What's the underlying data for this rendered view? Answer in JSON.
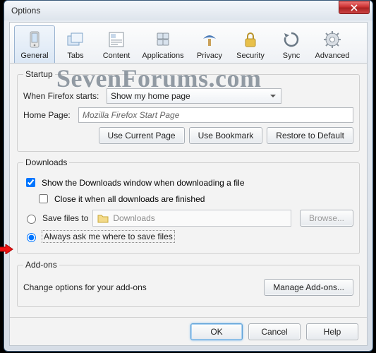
{
  "window": {
    "title": "Options"
  },
  "tabs": {
    "general": "General",
    "tabs": "Tabs",
    "content": "Content",
    "applications": "Applications",
    "privacy": "Privacy",
    "security": "Security",
    "sync": "Sync",
    "advanced": "Advanced"
  },
  "watermark": "SevenForums.com",
  "startup": {
    "legend": "Startup",
    "when_label": "When Firefox starts:",
    "when_value": "Show my home page",
    "home_label": "Home Page:",
    "home_value": "Mozilla Firefox Start Page",
    "btn_current": "Use Current Page",
    "btn_bookmark": "Use Bookmark",
    "btn_restore": "Restore to Default"
  },
  "downloads": {
    "legend": "Downloads",
    "show_window": "Show the Downloads window when downloading a file",
    "close_when_done": "Close it when all downloads are finished",
    "save_to_label": "Save files to",
    "save_to_folder": "Downloads",
    "browse": "Browse...",
    "ask_label": "Always ask me where to save files"
  },
  "addons": {
    "legend": "Add-ons",
    "desc": "Change options for your add-ons",
    "manage": "Manage Add-ons..."
  },
  "buttons": {
    "ok": "OK",
    "cancel": "Cancel",
    "help": "Help"
  }
}
